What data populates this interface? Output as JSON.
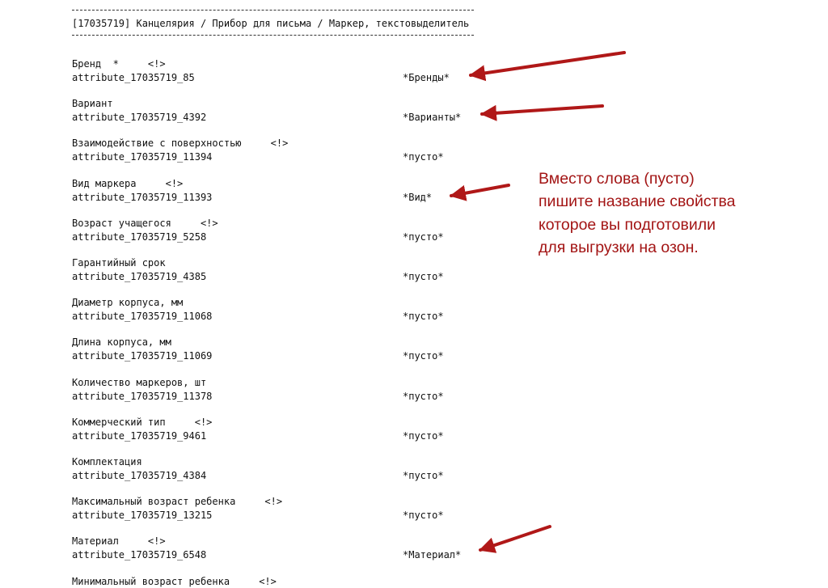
{
  "separator": "-------------------------------------------------------------------",
  "header": "[17035719] Канцелярия / Прибор для письма / Маркер, текстовыделитель",
  "attributes": [
    {
      "name": "Бренд  *     <!>",
      "id": "attribute_17035719_85",
      "value": "*Бренды*"
    },
    {
      "name": "Вариант",
      "id": "attribute_17035719_4392",
      "value": "*Варианты*"
    },
    {
      "name": "Взаимодействие с поверхностью     <!>",
      "id": "attribute_17035719_11394",
      "value": "*пусто*"
    },
    {
      "name": "Вид маркера     <!>",
      "id": "attribute_17035719_11393",
      "value": "*Вид*"
    },
    {
      "name": "Возраст учащегося     <!>",
      "id": "attribute_17035719_5258",
      "value": "*пусто*"
    },
    {
      "name": "Гарантийный срок",
      "id": "attribute_17035719_4385",
      "value": "*пусто*"
    },
    {
      "name": "Диаметр корпуса, мм",
      "id": "attribute_17035719_11068",
      "value": "*пусто*"
    },
    {
      "name": "Длина корпуса, мм",
      "id": "attribute_17035719_11069",
      "value": "*пусто*"
    },
    {
      "name": "Количество маркеров, шт",
      "id": "attribute_17035719_11378",
      "value": "*пусто*"
    },
    {
      "name": "Коммерческий тип     <!>",
      "id": "attribute_17035719_9461",
      "value": "*пусто*"
    },
    {
      "name": "Комплектация",
      "id": "attribute_17035719_4384",
      "value": "*пусто*"
    },
    {
      "name": "Максимальный возраст ребенка     <!>",
      "id": "attribute_17035719_13215",
      "value": "*пусто*"
    },
    {
      "name": "Материал     <!>",
      "id": "attribute_17035719_6548",
      "value": "*Материал*"
    },
    {
      "name": "Минимальный возраст ребенка     <!>",
      "id": "",
      "value": ""
    }
  ],
  "note": "Вместо слова (пусто)\nпишите название свойства\nкоторое вы подготовили\nдля выгрузки на озон.",
  "colors": {
    "annotation": "#a31515",
    "arrow": "#b01818",
    "text": "#111111"
  },
  "arrows": [
    {
      "name": "arrow-to-brand"
    },
    {
      "name": "arrow-to-variant"
    },
    {
      "name": "arrow-to-type"
    },
    {
      "name": "arrow-to-material"
    }
  ]
}
